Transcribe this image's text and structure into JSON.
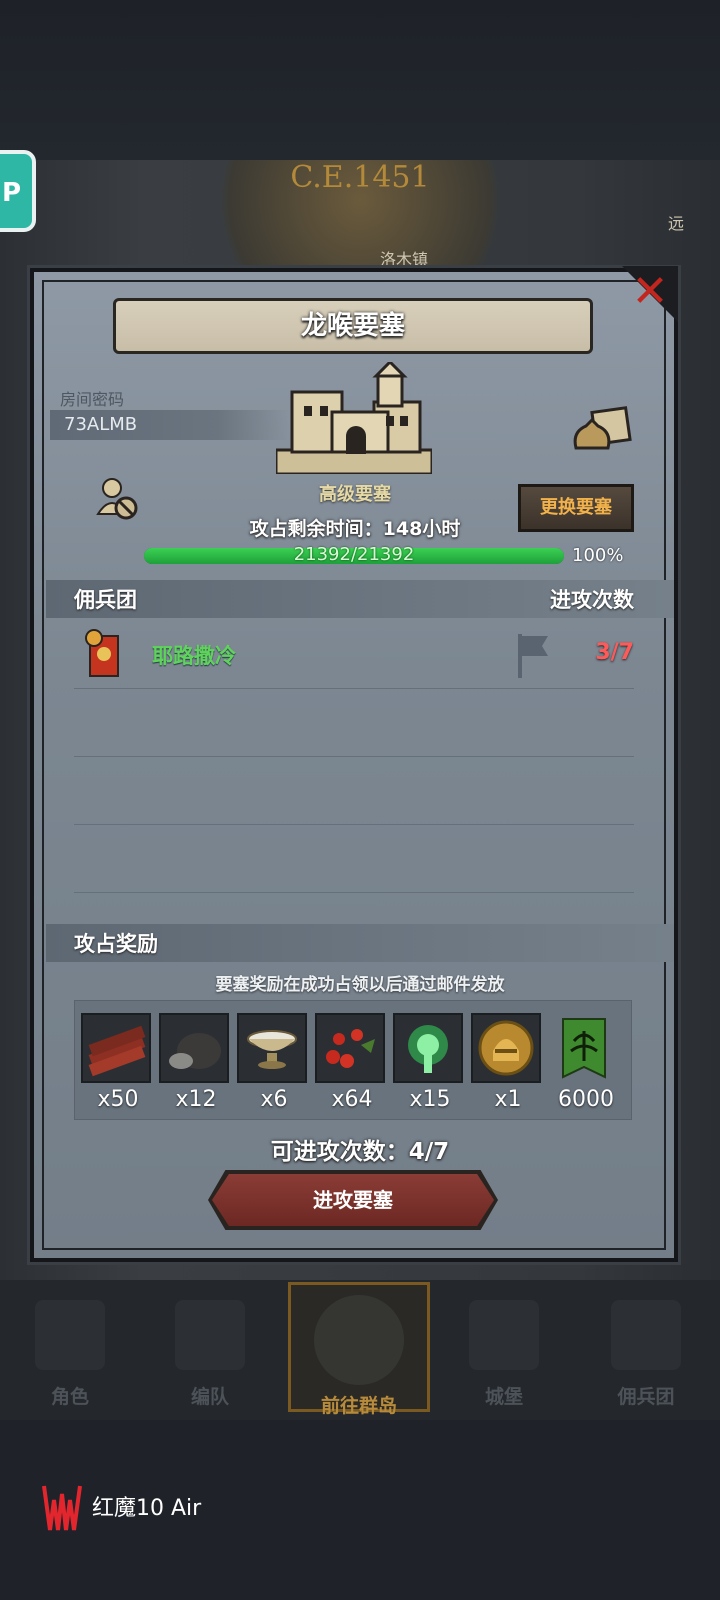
{
  "background": {
    "era_label": "C.E.1451",
    "town_label": "洛木镇",
    "far_label": "远"
  },
  "side_badge": "P",
  "panel": {
    "title": "龙喉要塞",
    "room_password_label": "房间密码",
    "room_password_value": "73ALMB",
    "fortress_type": "高级要塞",
    "change_button": "更换要塞",
    "occupy_time": "攻占剩余时间：148小时",
    "hp": {
      "current": 21392,
      "max": 21392,
      "text": "21392/21392",
      "percent_text": "100%",
      "fraction": 1.0
    },
    "mercenary_header": "佣兵团",
    "attack_count_header": "进攻次数",
    "rows": [
      {
        "name": "耶路撒冷",
        "attacks": "3/7"
      }
    ],
    "reward_header": "攻占奖励",
    "reward_note": "要塞奖励在成功占领以后通过邮件发放",
    "rewards": [
      {
        "icon": "wood-planks-icon",
        "count": "x50"
      },
      {
        "icon": "ore-rock-icon",
        "count": "x12"
      },
      {
        "icon": "silver-bowl-icon",
        "count": "x6"
      },
      {
        "icon": "red-berries-icon",
        "count": "x64"
      },
      {
        "icon": "green-tree-spirit-icon",
        "count": "x15"
      },
      {
        "icon": "golden-helmet-icon",
        "count": "x1"
      },
      {
        "icon": "green-tree-banner-icon",
        "count": "6000"
      }
    ],
    "attacks_available": "可进攻次数：4/7",
    "attack_button": "进攻要塞"
  },
  "nav": [
    {
      "label": "角色",
      "icon": "knight-icon",
      "active": false
    },
    {
      "label": "编队",
      "icon": "warhorse-icon",
      "active": false
    },
    {
      "label": "前往群岛",
      "icon": "islands-compass-icon",
      "active": true
    },
    {
      "label": "城堡",
      "icon": "castle-icon",
      "active": false
    },
    {
      "label": "佣兵团",
      "icon": "mercenary-icon",
      "active": false
    }
  ],
  "device_label": "红魔10 Air",
  "colors": {
    "hp_green": "#2fbe47",
    "attack_count_red": "#ff5a5a",
    "merc_name_green": "#5fd45a",
    "change_button_text": "#f2b24b",
    "attack_button_bg": "#7a3029"
  }
}
